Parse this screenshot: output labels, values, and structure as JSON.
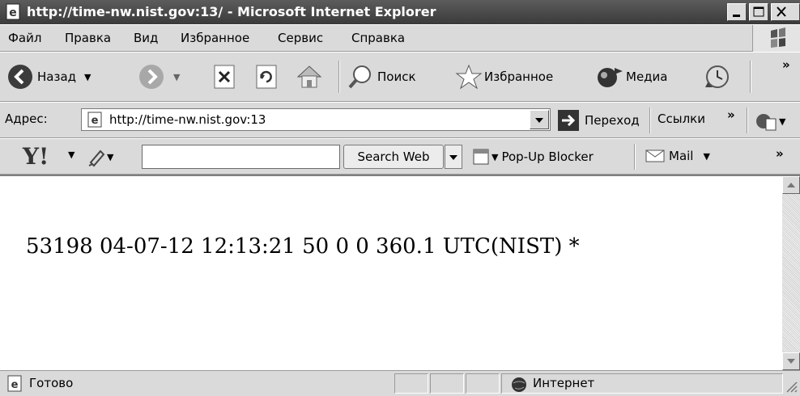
{
  "window": {
    "title": "http://time-nw.nist.gov:13/ - Microsoft Internet Explorer",
    "minimize_glyph": "_",
    "close_glyph": "×"
  },
  "menu": {
    "items": [
      "Файл",
      "Правка",
      "Вид",
      "Избранное",
      "Сервис",
      "Справка"
    ]
  },
  "toolbar": {
    "back_label": "Назад",
    "search_label": "Поиск",
    "favorites_label": "Избранное",
    "media_label": "Медиа",
    "more_glyph": "»"
  },
  "address": {
    "label": "Адрес:",
    "value": "http://time-nw.nist.gov:13",
    "go_label": "Переход",
    "links_label": "Ссылки",
    "links_more": "»"
  },
  "yahoo": {
    "logo": "Y!",
    "search_button": "Search Web",
    "popup_label": "Pop-Up Blocker",
    "mail_label": "Mail",
    "more_glyph": "»"
  },
  "page": {
    "body_text": "53198 04-07-12 12:13:21 50 0 0 360.1 UTC(NIST) *"
  },
  "status": {
    "text": "Готово",
    "zone": "Интернет"
  },
  "icons": {
    "ie": "ie-page-icon",
    "back": "back-arrow-icon",
    "forward": "forward-arrow-icon",
    "stop": "stop-icon",
    "refresh": "refresh-icon",
    "home": "home-icon",
    "search": "search-magnifier-icon",
    "favorites": "star-icon",
    "media": "media-icon",
    "history": "history-icon",
    "go": "go-arrow-icon",
    "globe": "globe-icon",
    "mail": "envelope-icon"
  }
}
